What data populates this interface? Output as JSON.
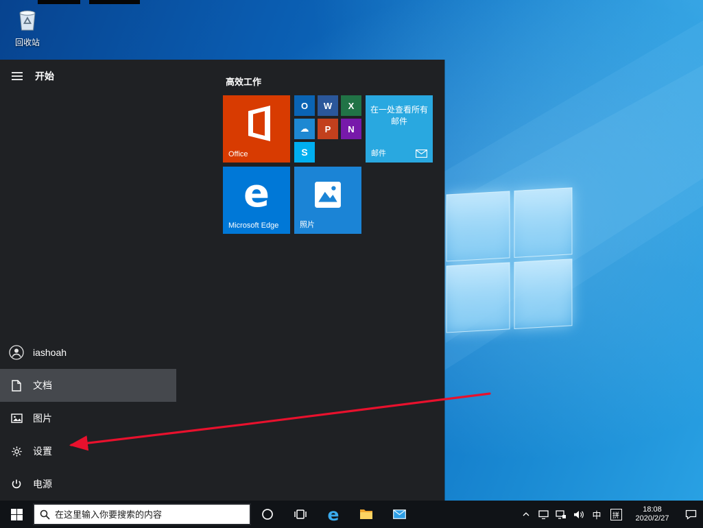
{
  "desktop": {
    "recycle_bin": {
      "label": "回收站"
    }
  },
  "start_menu": {
    "start_label": "开始",
    "sidebar": [
      {
        "id": "user",
        "label": "iashoah"
      },
      {
        "id": "documents",
        "label": "文档"
      },
      {
        "id": "pictures",
        "label": "图片"
      },
      {
        "id": "settings",
        "label": "设置"
      },
      {
        "id": "power",
        "label": "电源"
      }
    ],
    "tile_group": {
      "title": "高效工作",
      "office_tile": {
        "label": "Office",
        "color": "#d83b01"
      },
      "office_apps": [
        {
          "name": "Outlook",
          "glyph": "O",
          "color": "#0a64b4"
        },
        {
          "name": "Word",
          "glyph": "W",
          "color": "#2b579a"
        },
        {
          "name": "Excel",
          "glyph": "X",
          "color": "#217346"
        },
        {
          "name": "OneDrive",
          "glyph": "☁",
          "color": "#1e88d2"
        },
        {
          "name": "PowerPoint",
          "glyph": "P",
          "color": "#c2401d"
        },
        {
          "name": "OneNote",
          "glyph": "N",
          "color": "#7719aa"
        },
        {
          "name": "Skype",
          "glyph": "S",
          "color": "#00aff0"
        }
      ],
      "mail_tile": {
        "promo": "在一处查看所有邮件",
        "label": "邮件",
        "color": "#29a8e0"
      },
      "edge_tile": {
        "glyph": "e",
        "label": "Microsoft Edge",
        "color": "#0078d7"
      },
      "photos_tile": {
        "label": "照片",
        "color": "#1b84d6"
      }
    }
  },
  "taskbar": {
    "search_placeholder": "在这里输入你要搜索的内容",
    "edge_glyph": "e",
    "tray": {
      "ime_lang": "中",
      "ime_mode": "拼",
      "time": "18:08",
      "date": "2020/2/27"
    }
  },
  "colors": {
    "start_menu_bg": "#1f2124",
    "sidebar_highlight": "#45484d",
    "taskbar_bg": "#101317",
    "annotation_arrow": "#e8112d"
  }
}
